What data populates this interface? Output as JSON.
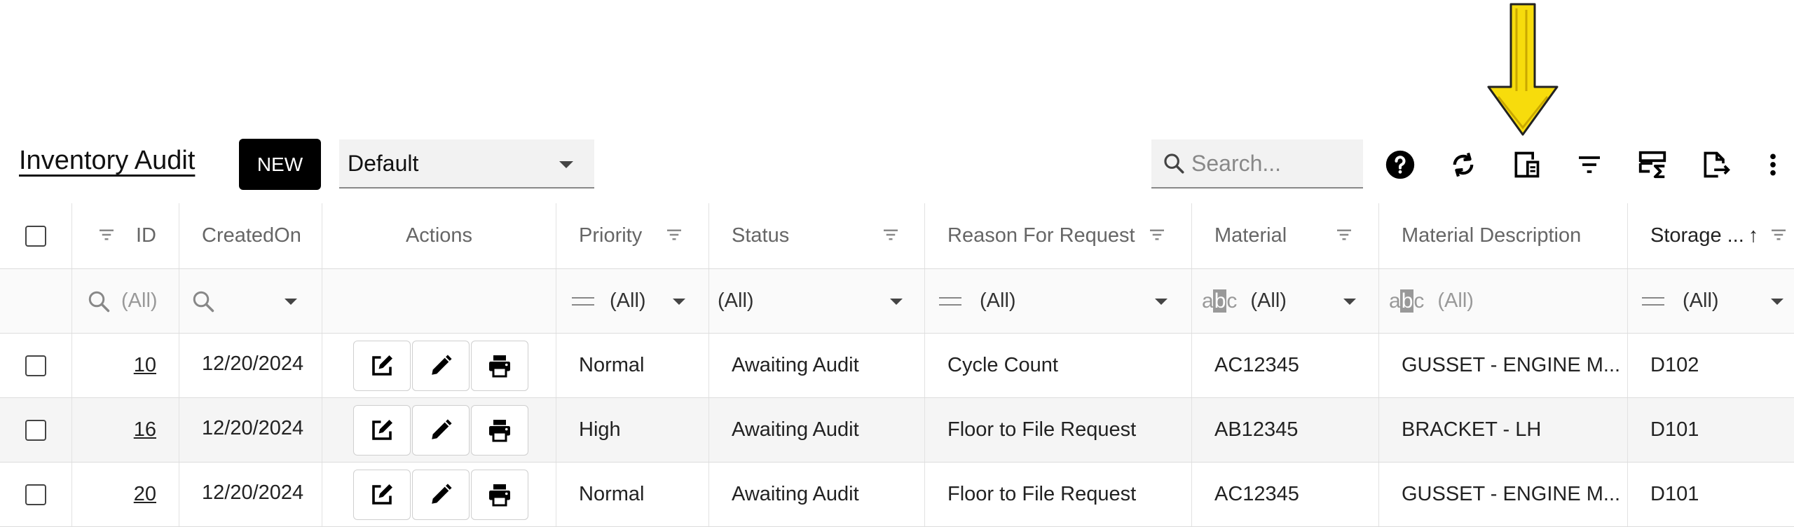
{
  "header": {
    "title": "Inventory Audit",
    "new_label": "NEW",
    "layout_value": "Default",
    "search_placeholder": "Search..."
  },
  "toolbar_icons": [
    "help-icon",
    "refresh-icon",
    "column-chooser-icon",
    "filter-icon",
    "summary-icon",
    "export-icon",
    "more-options-icon"
  ],
  "annotation": {
    "color": "#f5d90a",
    "target": "column-chooser-icon"
  },
  "columns": {
    "id": "ID",
    "created_on": "CreatedOn",
    "actions": "Actions",
    "priority": "Priority",
    "status": "Status",
    "reason": "Reason For Request",
    "material": "Material",
    "material_desc": "Material Description",
    "storage": "Storage ...",
    "storage_sort": "↑"
  },
  "filters": {
    "id": "(All)",
    "priority": "(All)",
    "status": "(All)",
    "reason": "(All)",
    "material": "(All)",
    "material_desc": "(All)",
    "storage": "(All)"
  },
  "rows": [
    {
      "id": "10",
      "created_on": "12/20/2024",
      "priority": "Normal",
      "status": "Awaiting Audit",
      "reason": "Cycle Count",
      "material": "AC12345",
      "material_desc": "GUSSET - ENGINE M...",
      "storage": "D102"
    },
    {
      "id": "16",
      "created_on": "12/20/2024",
      "priority": "High",
      "status": "Awaiting Audit",
      "reason": "Floor to File Request",
      "material": "AB12345",
      "material_desc": "BRACKET - LH",
      "storage": "D101"
    },
    {
      "id": "20",
      "created_on": "12/20/2024",
      "priority": "Normal",
      "status": "Awaiting Audit",
      "reason": "Floor to File Request",
      "material": "AC12345",
      "material_desc": "GUSSET - ENGINE M...",
      "storage": "D101"
    }
  ],
  "colors": {
    "accent": "#000000",
    "row_alt": "#f5f5f5",
    "filter_row": "#fafafa"
  }
}
